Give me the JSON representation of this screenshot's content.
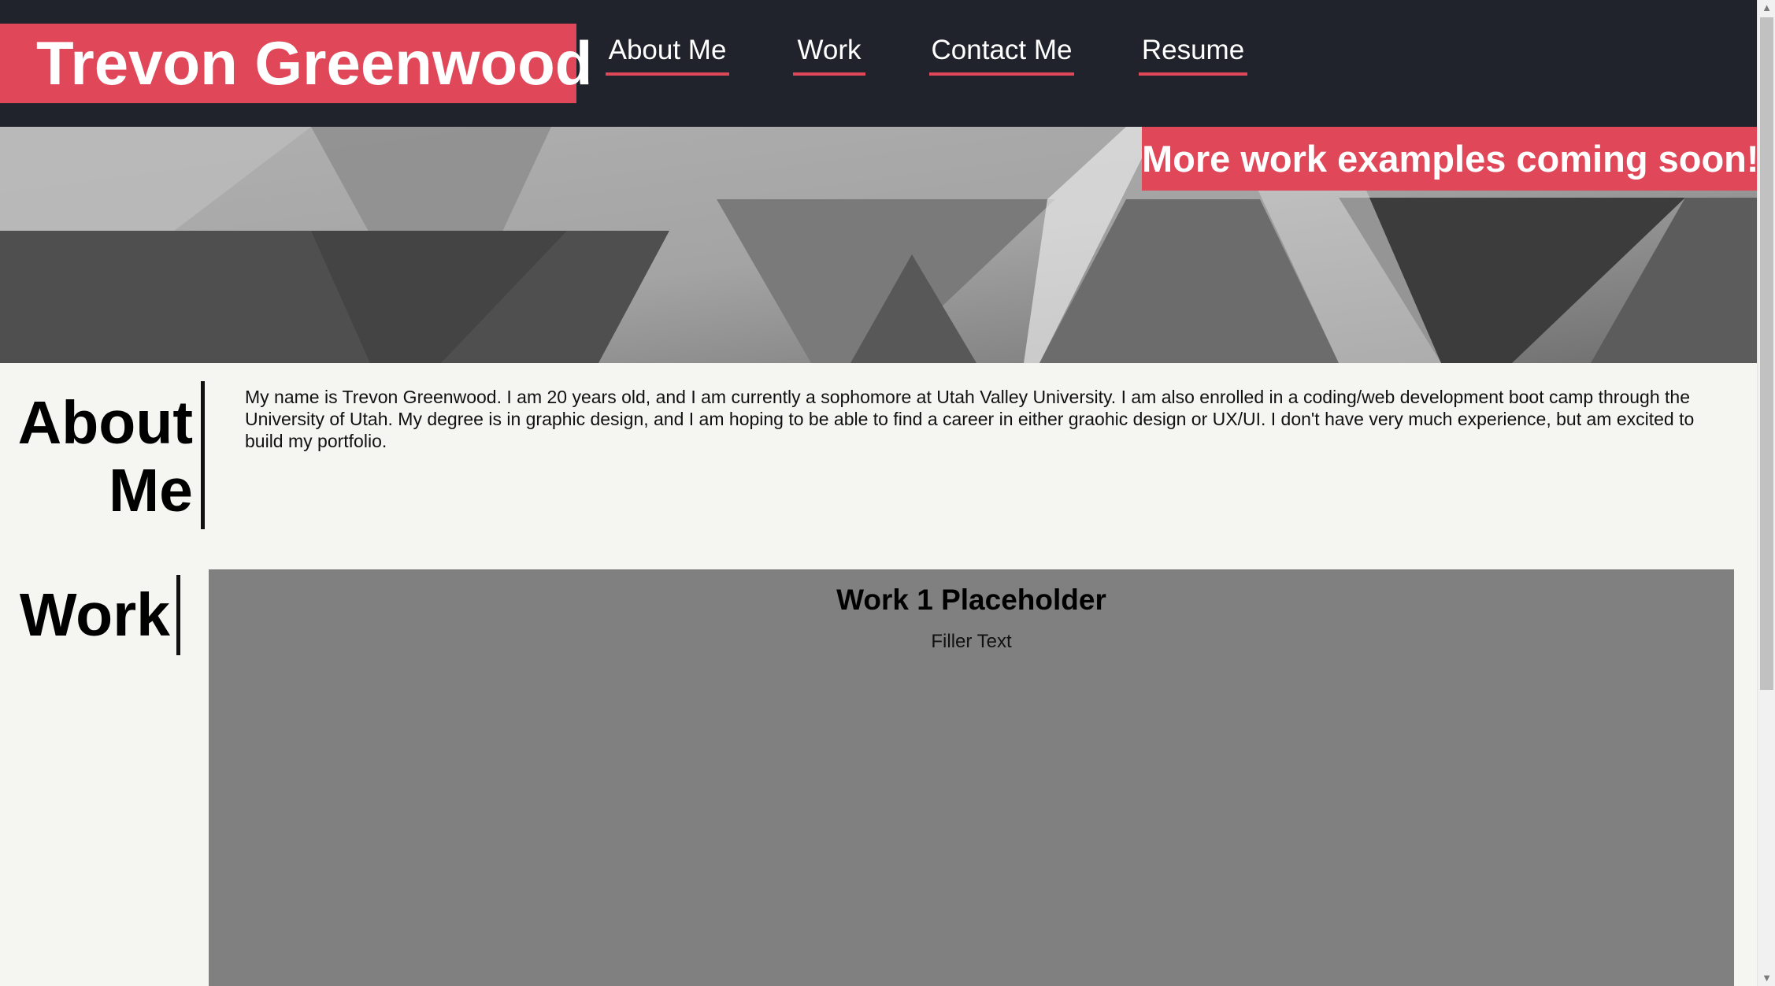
{
  "header": {
    "brand": "Trevon Greenwood",
    "nav": [
      {
        "label": "About Me"
      },
      {
        "label": "Work"
      },
      {
        "label": "Contact Me"
      },
      {
        "label": "Resume"
      }
    ]
  },
  "hero": {
    "banner": "More work examples coming soon!"
  },
  "about": {
    "heading_line1": "About",
    "heading_line2": "Me",
    "text": "My name is Trevon Greenwood. I am 20 years old, and I am currently a sophomore at Utah Valley University. I am also enrolled in a coding/web development boot camp through the University of Utah. My degree is in graphic design, and I am hoping to be able to find a career in either graohic design or UX/UI. I don't have very much experience, but am excited to build my portfolio."
  },
  "work": {
    "heading": "Work",
    "items": [
      {
        "title": "Work 1 Placeholder",
        "description": "Filler Text"
      }
    ]
  },
  "scrollbar": {
    "up_icon": "▲",
    "down_icon": "▼"
  },
  "colors": {
    "accent": "#e0485a",
    "header_bg": "#20232b",
    "page_bg": "#f5f5f2",
    "card_bg": "#808080"
  }
}
